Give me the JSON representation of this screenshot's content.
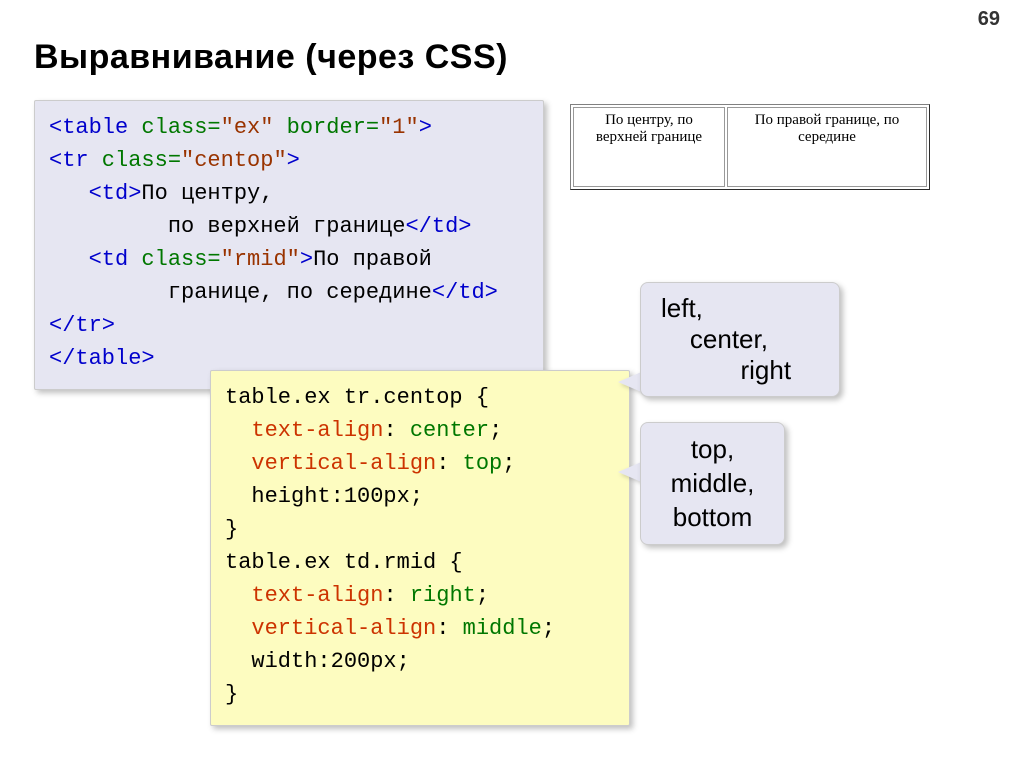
{
  "page_number": "69",
  "title": "Выравнивание (через CSS)",
  "html_code": {
    "line1_a": "<table",
    "line1_b": " class=",
    "line1_c": "\"ex\"",
    "line1_d": " border=",
    "line1_e": "\"1\"",
    "line1_f": ">",
    "line2_a": "<tr",
    "line2_b": " class=",
    "line2_c": "\"centop\"",
    "line2_d": ">",
    "line3_a": "   <td>",
    "line3_b": "По центру,",
    "line4": "         по верхней границе",
    "line4_b": "</td>",
    "line5_a": "   <td",
    "line5_b": " class=",
    "line5_c": "\"rmid\"",
    "line5_d": ">",
    "line5_e": "По правой",
    "line6": "         границе, по середине",
    "line6_b": "</td>",
    "line7": "</tr>",
    "line8": "</table>"
  },
  "css_code": {
    "sel1": "table.ex tr.centop {",
    "p1": "text-align",
    "v1": "center",
    "p2": "vertical-align",
    "v2": "top",
    "line_h": "  height:100px;",
    "close1": "}",
    "sel2": "table.ex td.rmid {",
    "p3": "text-align",
    "v3": "right",
    "p4": "vertical-align",
    "v4": "middle",
    "line_w": "  width:200px;",
    "close2": "}"
  },
  "example": {
    "cell1": "По центру, по верхней границе",
    "cell2": "По правой границе, по середине"
  },
  "callout1_text": "left,\n    center,\n           right",
  "callout2_text": "top,\nmiddle,\nbottom"
}
